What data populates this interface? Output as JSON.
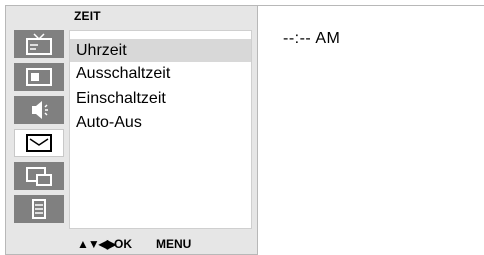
{
  "menu": {
    "title": "ZEIT",
    "items": [
      {
        "label": "Uhrzeit",
        "selected": true
      },
      {
        "label": "Ausschaltzeit",
        "selected": false
      },
      {
        "label": "Einschaltzeit",
        "selected": false
      },
      {
        "label": "Auto-Aus",
        "selected": false
      }
    ]
  },
  "sidebar": {
    "icons": [
      {
        "name": "tv-icon",
        "active": false
      },
      {
        "name": "picture-icon",
        "active": false
      },
      {
        "name": "speaker-icon",
        "active": false
      },
      {
        "name": "time-icon",
        "active": true
      },
      {
        "name": "screen-icon",
        "active": false
      },
      {
        "name": "special-icon",
        "active": false
      }
    ]
  },
  "footer": {
    "arrows": "▲▼◀▶",
    "ok_label": "OK",
    "menu_label": "MENU"
  },
  "time": {
    "value": "--:--  AM"
  },
  "colors": {
    "panel": "#e6e6e6",
    "icon_bg": "#808080",
    "selected_bg": "#d8d8d8"
  }
}
